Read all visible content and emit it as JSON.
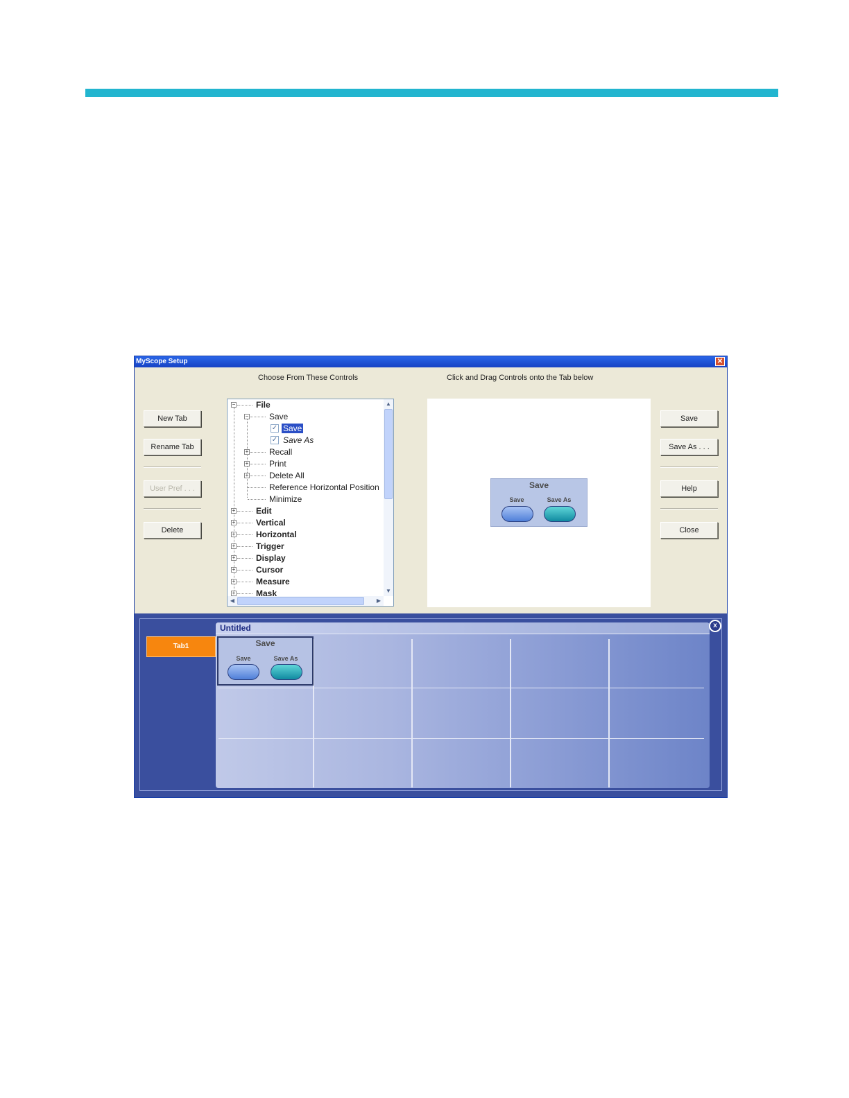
{
  "window": {
    "title": "MyScope Setup",
    "close_glyph": "✕"
  },
  "headers": {
    "choose": "Choose From These Controls",
    "drag": "Click and Drag Controls onto the Tab below"
  },
  "left_buttons": {
    "new_tab": "New Tab",
    "rename_tab": "Rename Tab",
    "user_pref": "User Pref . . .",
    "delete": "Delete"
  },
  "right_buttons": {
    "save": "Save",
    "save_as": "Save As . . .",
    "help": "Help",
    "close": "Close"
  },
  "tree": {
    "file": "File",
    "save": "Save",
    "save_item": "Save",
    "save_as_item": "Save As",
    "recall": "Recall",
    "print": "Print",
    "delete_all": "Delete All",
    "ref_horiz": "Reference Horizontal Position",
    "minimize": "Minimize",
    "edit": "Edit",
    "vertical": "Vertical",
    "horizontal": "Horizontal",
    "trigger": "Trigger",
    "display": "Display",
    "cursor": "Cursor",
    "measure": "Measure",
    "mask": "Mask",
    "expand_glyph": "+",
    "collapse_glyph": "−",
    "check_glyph": "✓"
  },
  "preview_group": {
    "title": "Save",
    "save": "Save",
    "save_as": "Save As"
  },
  "bottom": {
    "tab_label": "Tab1",
    "panel_title": "Untitled",
    "close_glyph": "x",
    "group": {
      "title": "Save",
      "save": "Save",
      "save_as": "Save As"
    }
  },
  "colors": {
    "accent_bar": "#22b5cf",
    "tab_orange": "#f7860e",
    "bottom_bg": "#3a4f9e"
  }
}
